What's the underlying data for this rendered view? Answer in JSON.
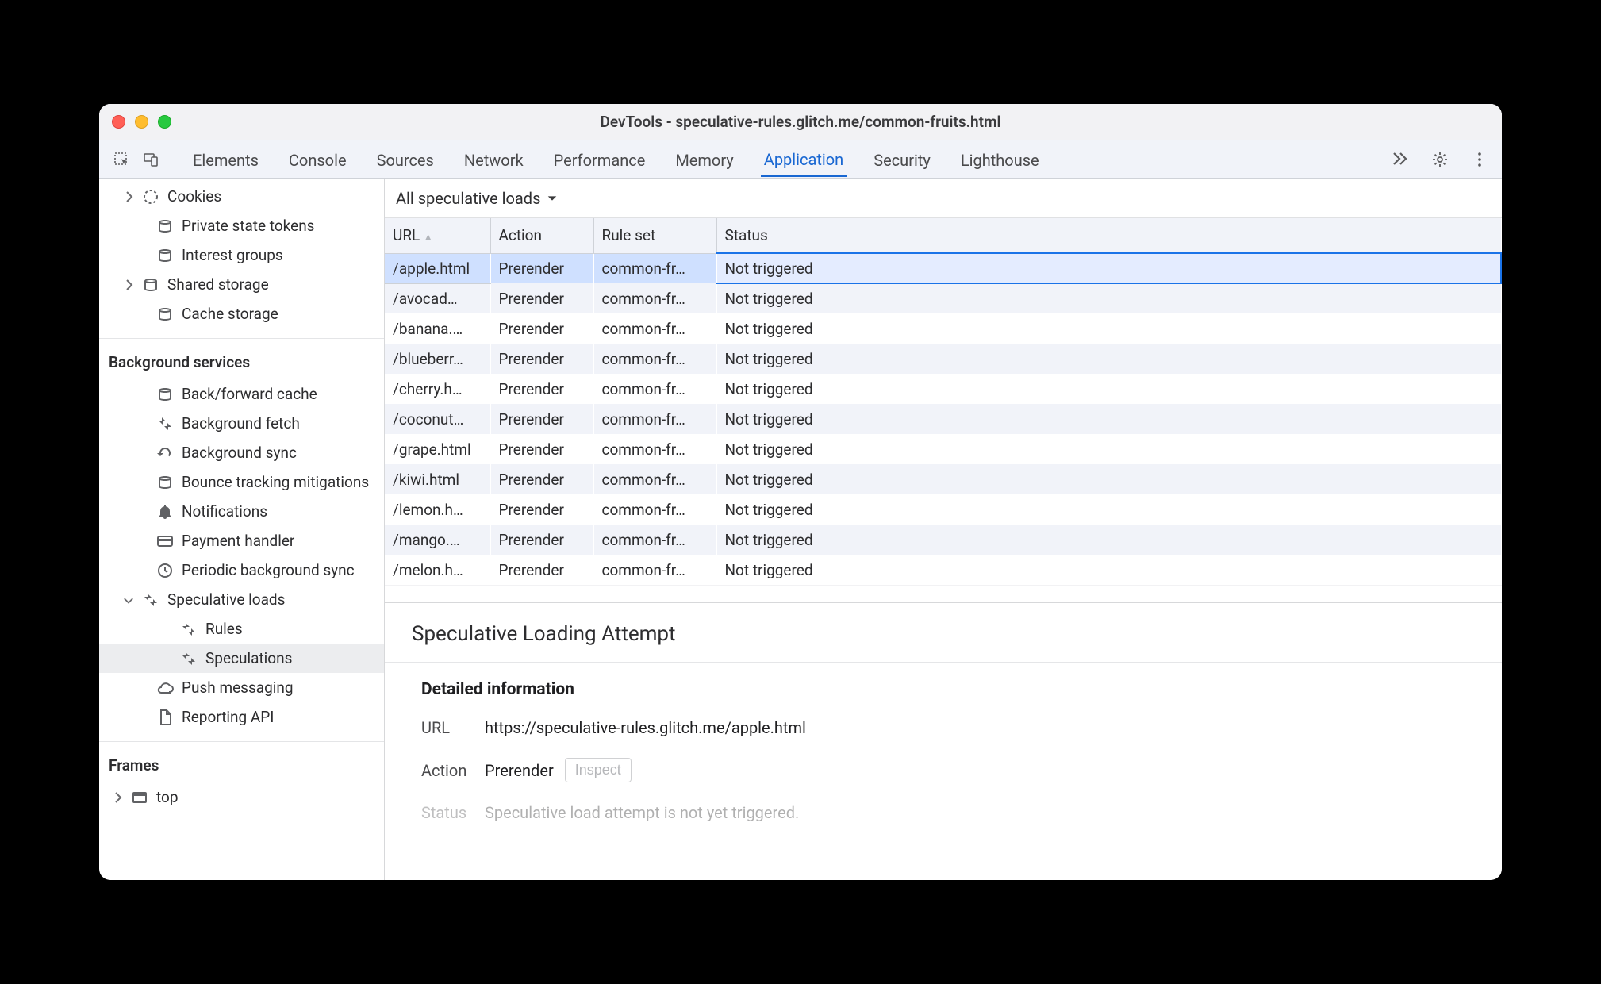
{
  "window": {
    "title": "DevTools - speculative-rules.glitch.me/common-fruits.html"
  },
  "tabs": {
    "items": [
      "Elements",
      "Console",
      "Sources",
      "Network",
      "Performance",
      "Memory",
      "Application",
      "Security",
      "Lighthouse"
    ],
    "active_index": 6
  },
  "sidebar": {
    "storage_items": [
      {
        "label": "Cookies",
        "icon": "cookie",
        "expand": "right",
        "indent": 30
      },
      {
        "label": "Private state tokens",
        "icon": "db",
        "expand": "none",
        "indent": 48
      },
      {
        "label": "Interest groups",
        "icon": "db",
        "expand": "none",
        "indent": 48
      },
      {
        "label": "Shared storage",
        "icon": "db",
        "expand": "right",
        "indent": 30
      },
      {
        "label": "Cache storage",
        "icon": "db",
        "expand": "none",
        "indent": 48
      }
    ],
    "bg_title": "Background services",
    "bg_items": [
      {
        "label": "Back/forward cache",
        "icon": "db",
        "expand": "none",
        "indent": 48
      },
      {
        "label": "Background fetch",
        "icon": "arrows",
        "expand": "none",
        "indent": 48
      },
      {
        "label": "Background sync",
        "icon": "sync",
        "expand": "none",
        "indent": 48
      },
      {
        "label": "Bounce tracking mitigations",
        "icon": "db",
        "expand": "none",
        "indent": 48
      },
      {
        "label": "Notifications",
        "icon": "bell",
        "expand": "none",
        "indent": 48
      },
      {
        "label": "Payment handler",
        "icon": "card",
        "expand": "none",
        "indent": 48
      },
      {
        "label": "Periodic background sync",
        "icon": "clock",
        "expand": "none",
        "indent": 48
      },
      {
        "label": "Speculative loads",
        "icon": "arrows",
        "expand": "down",
        "indent": 30
      },
      {
        "label": "Rules",
        "icon": "arrows",
        "expand": "none",
        "indent": 78
      },
      {
        "label": "Speculations",
        "icon": "arrows",
        "expand": "none",
        "indent": 78,
        "selected": true
      },
      {
        "label": "Push messaging",
        "icon": "cloud",
        "expand": "none",
        "indent": 48
      },
      {
        "label": "Reporting API",
        "icon": "file",
        "expand": "none",
        "indent": 48
      }
    ],
    "frames_title": "Frames",
    "frames_items": [
      {
        "label": "top",
        "icon": "frame",
        "expand": "right",
        "indent": 16
      }
    ]
  },
  "filter": {
    "label": "All speculative loads"
  },
  "columns": {
    "url": "URL",
    "action": "Action",
    "ruleset": "Rule set",
    "status": "Status"
  },
  "rows": [
    {
      "url": "/apple.html",
      "action": "Prerender",
      "ruleset": "common-fr…",
      "status": "Not triggered",
      "selected": true
    },
    {
      "url": "/avocad…",
      "action": "Prerender",
      "ruleset": "common-fr…",
      "status": "Not triggered"
    },
    {
      "url": "/banana.…",
      "action": "Prerender",
      "ruleset": "common-fr…",
      "status": "Not triggered"
    },
    {
      "url": "/blueberr…",
      "action": "Prerender",
      "ruleset": "common-fr…",
      "status": "Not triggered"
    },
    {
      "url": "/cherry.h…",
      "action": "Prerender",
      "ruleset": "common-fr…",
      "status": "Not triggered"
    },
    {
      "url": "/coconut…",
      "action": "Prerender",
      "ruleset": "common-fr…",
      "status": "Not triggered"
    },
    {
      "url": "/grape.html",
      "action": "Prerender",
      "ruleset": "common-fr…",
      "status": "Not triggered"
    },
    {
      "url": "/kiwi.html",
      "action": "Prerender",
      "ruleset": "common-fr…",
      "status": "Not triggered"
    },
    {
      "url": "/lemon.h…",
      "action": "Prerender",
      "ruleset": "common-fr…",
      "status": "Not triggered"
    },
    {
      "url": "/mango.…",
      "action": "Prerender",
      "ruleset": "common-fr…",
      "status": "Not triggered"
    },
    {
      "url": "/melon.h…",
      "action": "Prerender",
      "ruleset": "common-fr…",
      "status": "Not triggered"
    }
  ],
  "details": {
    "heading": "Speculative Loading Attempt",
    "section_title": "Detailed information",
    "url_label": "URL",
    "url_value": "https://speculative-rules.glitch.me/apple.html",
    "action_label": "Action",
    "action_value": "Prerender",
    "inspect_label": "Inspect",
    "status_label": "Status",
    "status_value": "Speculative load attempt is not yet triggered."
  }
}
